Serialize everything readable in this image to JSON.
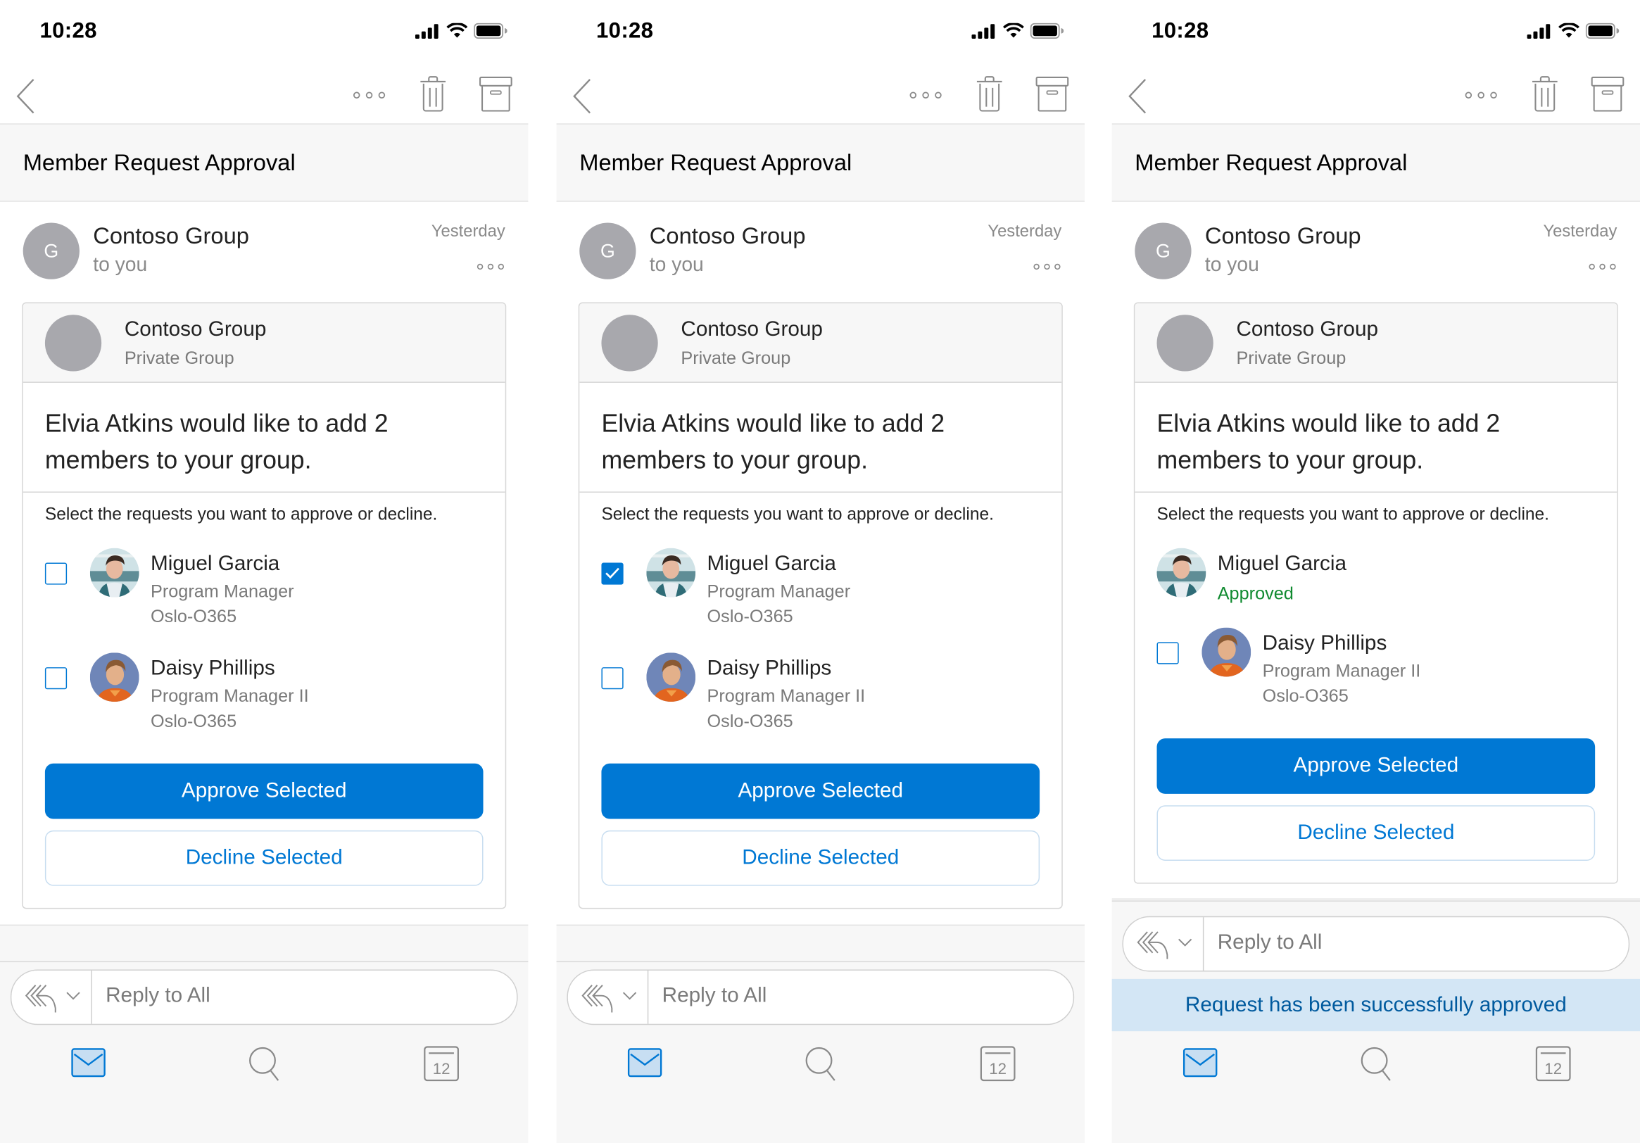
{
  "status_bar": {
    "time": "10:28"
  },
  "toolbar": {
    "back_icon": "chevron-left-icon",
    "more_icon": "more-icon",
    "delete_icon": "trash-icon",
    "archive_icon": "archive-icon"
  },
  "email": {
    "subject": "Member Request Approval",
    "sender": {
      "initial": "G",
      "name": "Contoso Group",
      "recipient": "to you",
      "date": "Yesterday"
    }
  },
  "card": {
    "group_name": "Contoso Group",
    "group_type": "Private Group",
    "title": "Elvia Atkins would like to add 2 members to your group.",
    "instructions": "Select the requests you want to approve or decline.",
    "approve_label": "Approve Selected",
    "decline_label": "Decline Selected"
  },
  "members": [
    {
      "name": "Miguel Garcia",
      "title": "Program Manager",
      "location": "Oslo-O365"
    },
    {
      "name": "Daisy Phillips",
      "title": "Program Manager II",
      "location": "Oslo-O365"
    }
  ],
  "screens": [
    {
      "label": "initial",
      "checked": [
        false,
        false
      ],
      "approved": [
        false,
        false
      ]
    },
    {
      "label": "selected",
      "checked": [
        true,
        false
      ],
      "approved": [
        false,
        false
      ]
    },
    {
      "label": "approved",
      "checked": [
        false,
        false
      ],
      "approved": [
        true,
        false
      ],
      "status_label": "Approved",
      "toast": "Request has been successfully approved"
    }
  ],
  "reply": {
    "placeholder": "Reply to All"
  },
  "tabbar": {
    "items": [
      {
        "name": "mail",
        "icon": "mail-icon",
        "active": true
      },
      {
        "name": "search",
        "icon": "search-icon",
        "active": false
      },
      {
        "name": "calendar",
        "icon": "calendar-icon",
        "date": "12",
        "active": false
      }
    ]
  },
  "colors": {
    "accent": "#0078d4",
    "approved": "#108a30",
    "toast_bg": "#d3e6f5",
    "toast_text": "#005a9e"
  }
}
